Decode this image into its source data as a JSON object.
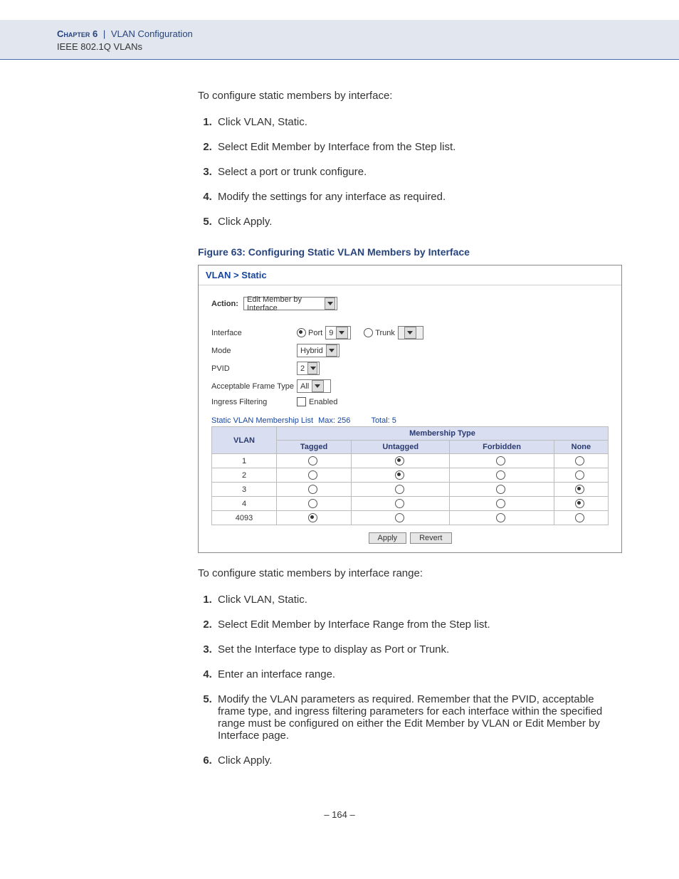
{
  "header": {
    "chapter": "Chapter 6",
    "topic": "VLAN Configuration",
    "section": "IEEE 802.1Q VLANs"
  },
  "intro1": "To configure static members by interface:",
  "steps1": [
    "Click VLAN, Static.",
    "Select Edit Member by Interface from the Step list.",
    "Select a port or trunk configure.",
    "Modify the settings for any interface as required.",
    "Click Apply."
  ],
  "figure": {
    "caption": "Figure 63:  Configuring Static VLAN Members by Interface",
    "breadcrumb": "VLAN > Static",
    "action_label": "Action:",
    "action_value": "Edit Member by Interface",
    "fields": {
      "interface": {
        "label": "Interface",
        "port_label": "Port",
        "port_value": "9",
        "trunk_label": "Trunk",
        "trunk_value": ""
      },
      "mode": {
        "label": "Mode",
        "value": "Hybrid"
      },
      "pvid": {
        "label": "PVID",
        "value": "2"
      },
      "aft": {
        "label": "Acceptable Frame Type",
        "value": "All"
      },
      "ingress": {
        "label": "Ingress Filtering",
        "checkbox_label": "Enabled"
      }
    },
    "list_header": {
      "title": "Static VLAN Membership List",
      "max_label": "Max: 256",
      "total_label": "Total: 5"
    },
    "table": {
      "vlan_header": "VLAN",
      "mt_header": "Membership Type",
      "cols": [
        "Tagged",
        "Untagged",
        "Forbidden",
        "None"
      ],
      "rows": [
        {
          "vlan": "1",
          "sel": 1
        },
        {
          "vlan": "2",
          "sel": 1
        },
        {
          "vlan": "3",
          "sel": 3
        },
        {
          "vlan": "4",
          "sel": 3
        },
        {
          "vlan": "4093",
          "sel": 0
        }
      ]
    },
    "buttons": {
      "apply": "Apply",
      "revert": "Revert"
    }
  },
  "intro2": "To configure static members by interface range:",
  "steps2": [
    "Click VLAN, Static.",
    "Select Edit Member by Interface Range from the Step list.",
    "Set the Interface type to display as Port or Trunk.",
    "Enter an interface range.",
    "Modify the VLAN parameters as required. Remember that the PVID, acceptable frame type, and ingress filtering parameters for each interface within the specified range must be configured on either the Edit Member by VLAN or Edit Member by Interface page.",
    "Click Apply."
  ],
  "page_number": "–  164  –"
}
